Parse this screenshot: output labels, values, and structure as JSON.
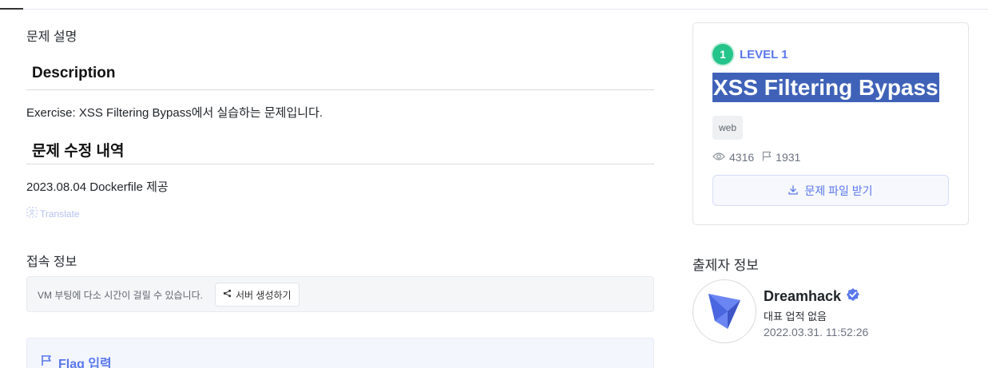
{
  "problem": {
    "section_title": "문제 설명",
    "description_heading": "Description",
    "description_text": "Exercise: XSS Filtering Bypass에서 실습하는 문제입니다.",
    "revision_heading": "문제 수정 내역",
    "revision_text": "2023.08.04 Dockerfile 제공",
    "translate_label": "Translate"
  },
  "connection": {
    "section_title": "접속 정보",
    "vm_notice": "VM 부팅에 다소 시간이 걸릴 수 있습니다.",
    "server_button": "서버 생성하기"
  },
  "flag": {
    "label": "Flag 입력"
  },
  "card": {
    "level_number": "1",
    "level_label": "LEVEL 1",
    "title": "XSS Filtering Bypass",
    "tag": "web",
    "views": "4316",
    "solves": "1931",
    "download_label": "문제 파일 받기"
  },
  "author": {
    "section_title": "출제자 정보",
    "name": "Dreamhack",
    "subtitle": "대표 업적 없음",
    "date": "2022.03.31. 11:52:26"
  },
  "colors": {
    "accent": "#5a78ec",
    "level_green": "#24c48a",
    "title_highlight": "#3f62b8"
  }
}
